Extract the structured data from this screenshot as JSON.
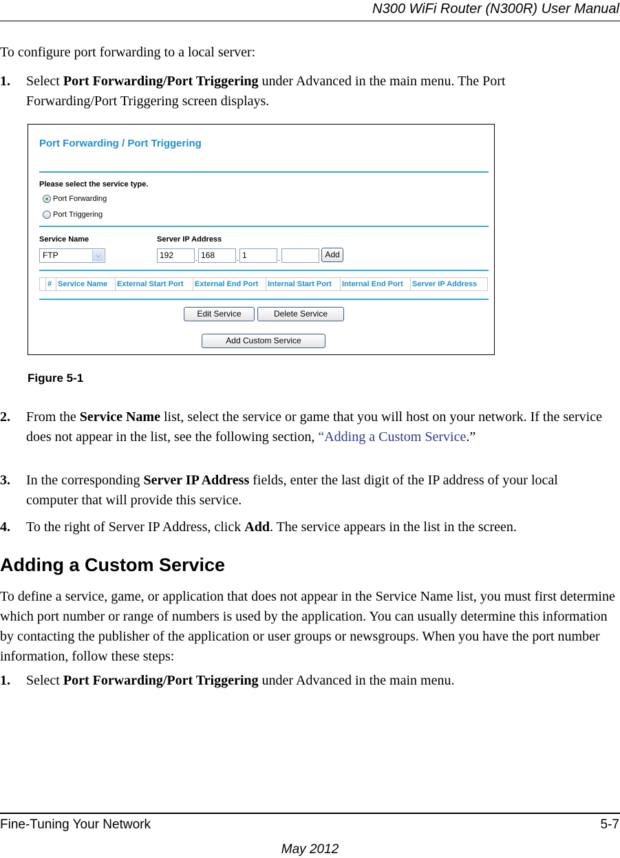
{
  "header": {
    "title": "N300 WiFi Router (N300R) User Manual"
  },
  "intro": "To configure port forwarding to a local server:",
  "steps_a": [
    {
      "num": "1.",
      "pre": "Select ",
      "bold": "Port Forwarding/Port Triggering",
      "post": " under Advanced in the main menu. The Port Forwarding/Port Triggering screen displays."
    },
    {
      "num": "2.",
      "pre": "From the ",
      "bold": "Service Name",
      "post": " list, select the service or game that you will host on your network. If the service does not appear in the list, see the following section, ",
      "link": "“Adding a Custom Service",
      "tail": ".”"
    },
    {
      "num": "3.",
      "pre": "In the corresponding ",
      "bold": "Server IP Address",
      "post": " fields, enter the last digit of the IP address of your local computer that will provide this service."
    },
    {
      "num": "4.",
      "pre": "To the right of Server IP Address, click ",
      "bold": "Add",
      "post": ". The service appears in the list in the screen."
    }
  ],
  "figure": {
    "caption": "Figure 5-1",
    "ui": {
      "title": "Port Forwarding / Port Triggering",
      "service_type_label": "Please select the service type.",
      "radio_options": [
        {
          "label": "Port Forwarding",
          "checked": true
        },
        {
          "label": "Port Triggering",
          "checked": false
        }
      ],
      "service_name_label": "Service Name",
      "service_name_value": "FTP",
      "server_ip_label": "Server IP Address",
      "ip_octets": [
        "192",
        "168",
        "1",
        ""
      ],
      "ip_separator": ".",
      "add_button": "Add",
      "table_columns": [
        "",
        "#",
        "Service Name",
        "External Start Port",
        "External End Port",
        "Internal Start Port",
        "Internal End Port",
        "Server IP Address"
      ],
      "edit_button": "Edit Service",
      "delete_button": "Delete Service",
      "add_custom_button": "Add Custom Service",
      "accent_color": "#1f8fcf"
    }
  },
  "section": {
    "heading": "Adding a Custom Service",
    "paragraph": "To define a service, game, or application that does not appear in the Service Name list, you must first determine which port number or range of numbers is used by the application. You can usually determine this information by contacting the publisher of the application or user groups or newsgroups. When you have the port number information, follow these steps:",
    "steps": [
      {
        "num": "1.",
        "pre": "Select ",
        "bold": "Port Forwarding/Port Triggering",
        "post": " under Advanced in the main menu."
      }
    ]
  },
  "footer": {
    "left": "Fine-Tuning Your Network",
    "right": "5-7",
    "date": "May 2012"
  }
}
